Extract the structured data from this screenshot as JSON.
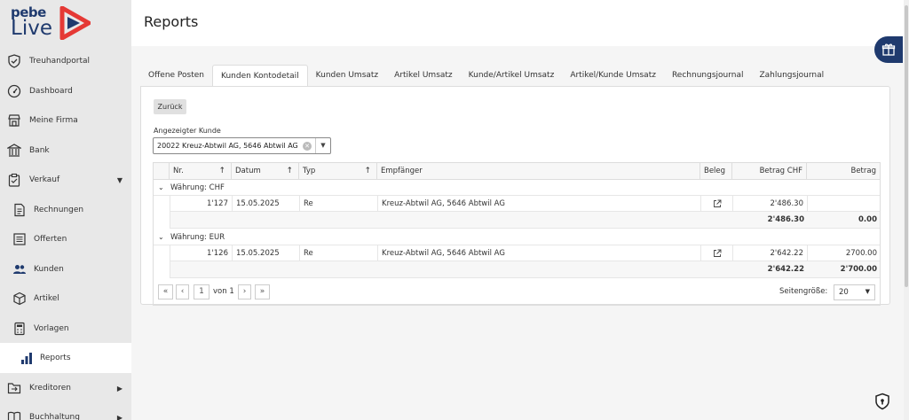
{
  "brand": {
    "top": "pebe",
    "bottom": "Live"
  },
  "sidebar": {
    "items": [
      {
        "label": "Treuhandportal",
        "icon": "shield-check-icon"
      },
      {
        "label": "Dashboard",
        "icon": "gauge-icon"
      },
      {
        "label": "Meine Firma",
        "icon": "store-icon"
      },
      {
        "label": "Bank",
        "icon": "bank-icon"
      },
      {
        "label": "Verkauf",
        "icon": "clipboard-check-icon"
      },
      {
        "label": "Rechnungen",
        "icon": "document-icon"
      },
      {
        "label": "Offerten",
        "icon": "list-icon"
      },
      {
        "label": "Kunden",
        "icon": "users-icon"
      },
      {
        "label": "Artikel",
        "icon": "box-icon"
      },
      {
        "label": "Vorlagen",
        "icon": "calculator-icon"
      },
      {
        "label": "Reports",
        "icon": "bar-chart-icon"
      },
      {
        "label": "Kreditoren",
        "icon": "folder-icon"
      },
      {
        "label": "Buchhaltung",
        "icon": "book-icon"
      }
    ]
  },
  "header": {
    "title": "Reports"
  },
  "tabs": [
    "Offene Posten",
    "Kunden Kontodetail",
    "Kunden Umsatz",
    "Artikel Umsatz",
    "Kunde/Artikel Umsatz",
    "Artikel/Kunde Umsatz",
    "Rechnungsjournal",
    "Zahlungsjournal"
  ],
  "panel": {
    "back_label": "Zurück",
    "customer_label": "Angezeigter Kunde",
    "customer_value": "20022 Kreuz-Abtwil AG, 5646 Abtwil AG"
  },
  "grid": {
    "columns": [
      "Nr.",
      "Datum",
      "Typ",
      "Empfänger",
      "Beleg",
      "Betrag CHF",
      "Betrag"
    ],
    "groups": [
      {
        "label": "Währung: CHF",
        "rows": [
          {
            "nr": "1'127",
            "datum": "15.05.2025",
            "typ": "Re",
            "empfaenger": "Kreuz-Abtwil AG, 5646 Abtwil AG",
            "betrag_chf": "2'486.30",
            "betrag": ""
          }
        ],
        "sum_chf": "2'486.30",
        "sum": "0.00"
      },
      {
        "label": "Währung: EUR",
        "rows": [
          {
            "nr": "1'126",
            "datum": "15.05.2025",
            "typ": "Re",
            "empfaenger": "Kreuz-Abtwil AG, 5646 Abtwil AG",
            "betrag_chf": "2'642.22",
            "betrag": "2700.00"
          }
        ],
        "sum_chf": "2'642.22",
        "sum": "2'700.00"
      }
    ]
  },
  "pager": {
    "page": "1",
    "of_label": "von 1",
    "size_label": "Seitengröße:",
    "size_value": "20"
  },
  "colors": {
    "brand_blue": "#1f3a6e",
    "brand_red": "#e53935"
  }
}
